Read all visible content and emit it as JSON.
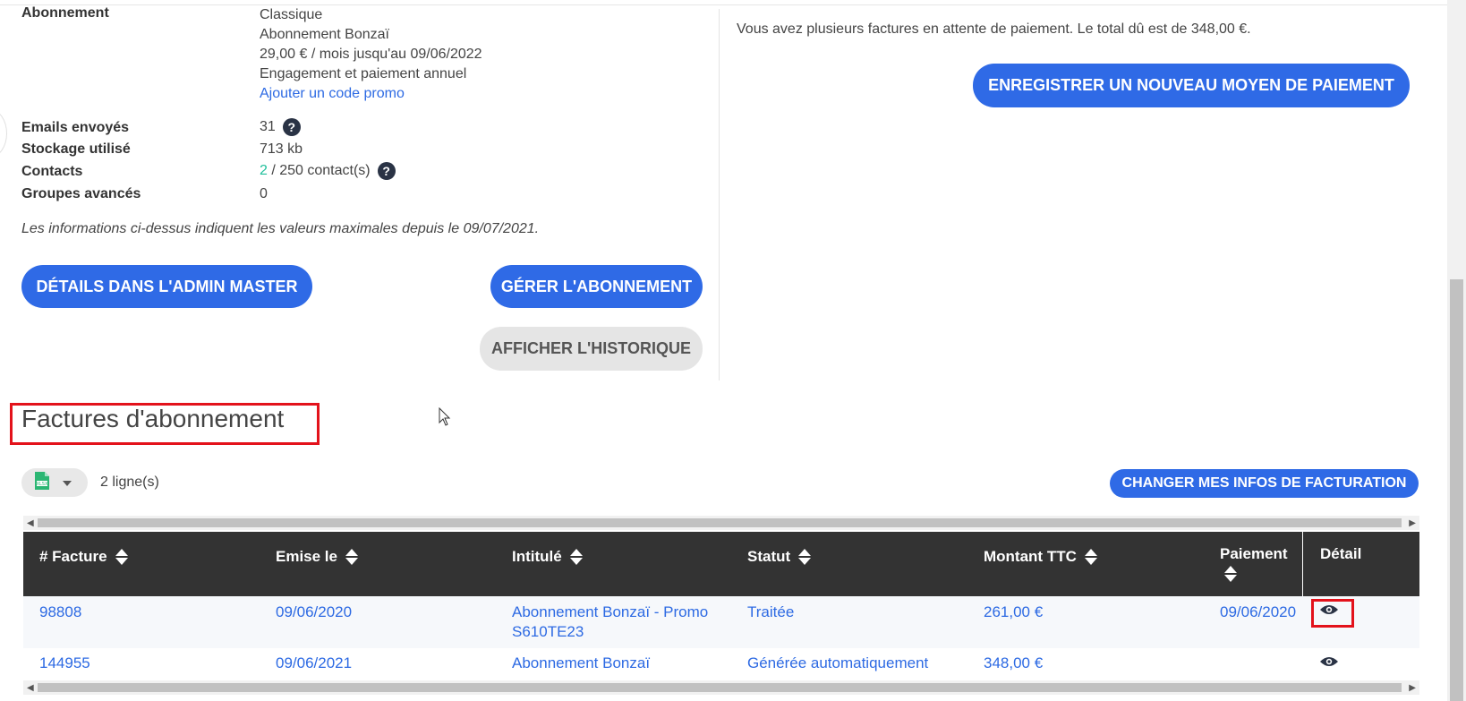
{
  "subscription": {
    "label": "Abonnement",
    "lines": [
      "Classique",
      "Abonnement Bonzaï",
      "29,00 € / mois jusqu'au 09/06/2022",
      "Engagement et paiement annuel"
    ],
    "promo_link": "Ajouter un code promo"
  },
  "stats": {
    "emails_label": "Emails envoyés",
    "emails_value": "31",
    "storage_label": "Stockage utilisé",
    "storage_value": "713 kb",
    "contacts_label": "Contacts",
    "contacts_count": "2",
    "contacts_rest": " / 250 contact(s)",
    "groups_label": "Groupes avancés",
    "groups_value": "0",
    "help_glyph": "?"
  },
  "note": "Les informations ci-dessus indiquent les valeurs maximales depuis le 09/07/2021.",
  "buttons": {
    "admin_master": "DÉTAILS DANS L'ADMIN MASTER",
    "manage": "GÉRER L'ABONNEMENT",
    "history": "AFFICHER L'HISTORIQUE",
    "new_payment": "ENREGISTRER UN NOUVEAU MOYEN DE PAIEMENT",
    "change_billing": "CHANGER MES INFOS DE FACTURATION"
  },
  "payment_notice": "Vous avez plusieurs factures en attente de paiement. Le total dû est de 348,00 €.",
  "invoices": {
    "title": "Factures d'abonnement",
    "row_count": "2 ligne(s)",
    "columns": [
      "# Facture",
      "Emise le",
      "Intitulé",
      "Statut",
      "Montant TTC",
      "Paiement",
      "Détail"
    ],
    "rows": [
      {
        "number": "98808",
        "date": "09/06/2020",
        "title": "Abonnement Bonzaï - Promo S610TE23",
        "status": "Traitée",
        "amount": "261,00 €",
        "payment": "09/06/2020"
      },
      {
        "number": "144955",
        "date": "09/06/2021",
        "title": "Abonnement Bonzaï",
        "status": "Générée automatiquement",
        "amount": "348,00 €",
        "payment": ""
      }
    ]
  },
  "colors": {
    "primary": "#2f6ae6",
    "link": "#2d6ae3",
    "header_bg": "#333333",
    "highlight": "#e3121b",
    "contacts_green": "#1fbf9a"
  },
  "icons": [
    "help-icon",
    "xlsx-file-icon",
    "caret-down-icon",
    "sort-icon",
    "eye-icon",
    "mouse-cursor-icon"
  ]
}
